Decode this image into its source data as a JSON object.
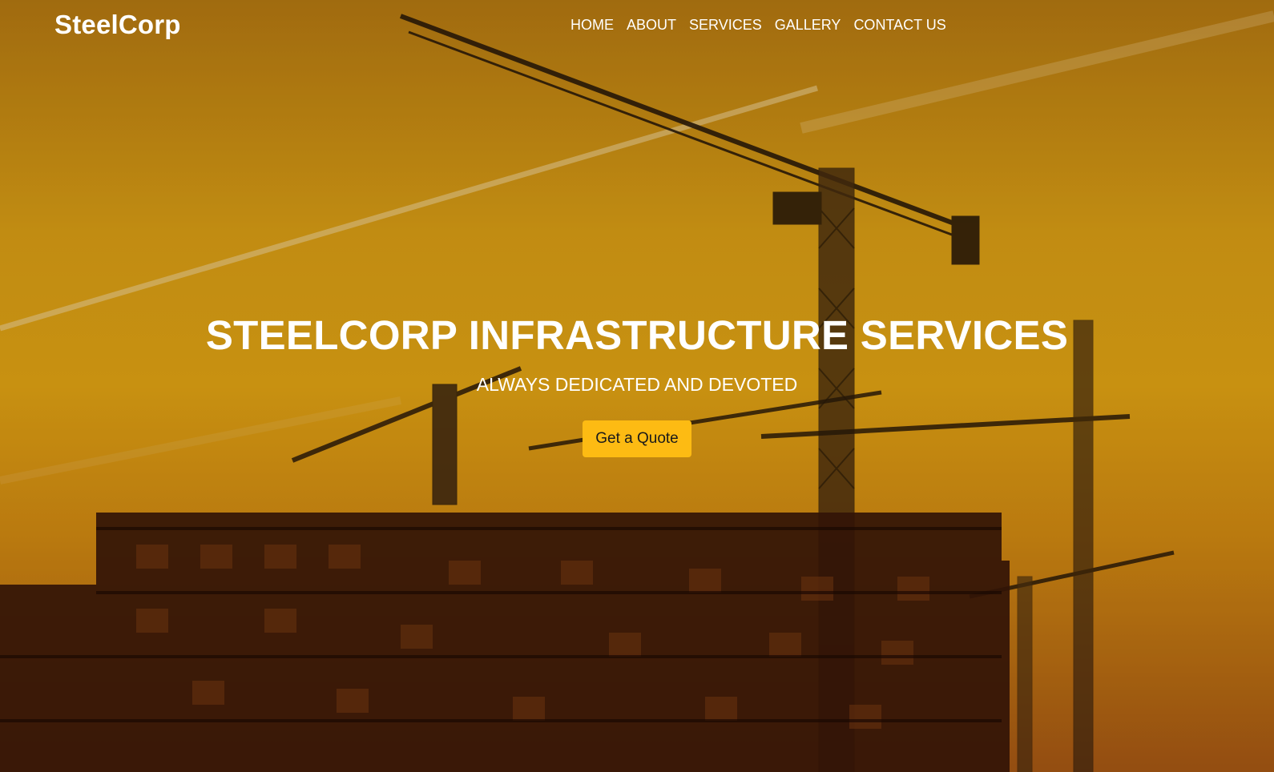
{
  "brand": {
    "name": "SteelCorp"
  },
  "nav": {
    "items": [
      {
        "label": "HOME"
      },
      {
        "label": "ABOUT"
      },
      {
        "label": "SERVICES"
      },
      {
        "label": "GALLERY"
      },
      {
        "label": "CONTACT US"
      }
    ]
  },
  "hero": {
    "title": "STEELCORP INFRASTRUCTURE SERVICES",
    "subtitle": "ALWAYS DEDICATED AND DEVOTED",
    "cta_label": "Get a Quote"
  },
  "colors": {
    "accent": "#fdbb13",
    "overlay_tint": "#e3a30f",
    "text": "#ffffff"
  },
  "icons": {
    "background": "construction-cranes-silhouette-photo"
  }
}
